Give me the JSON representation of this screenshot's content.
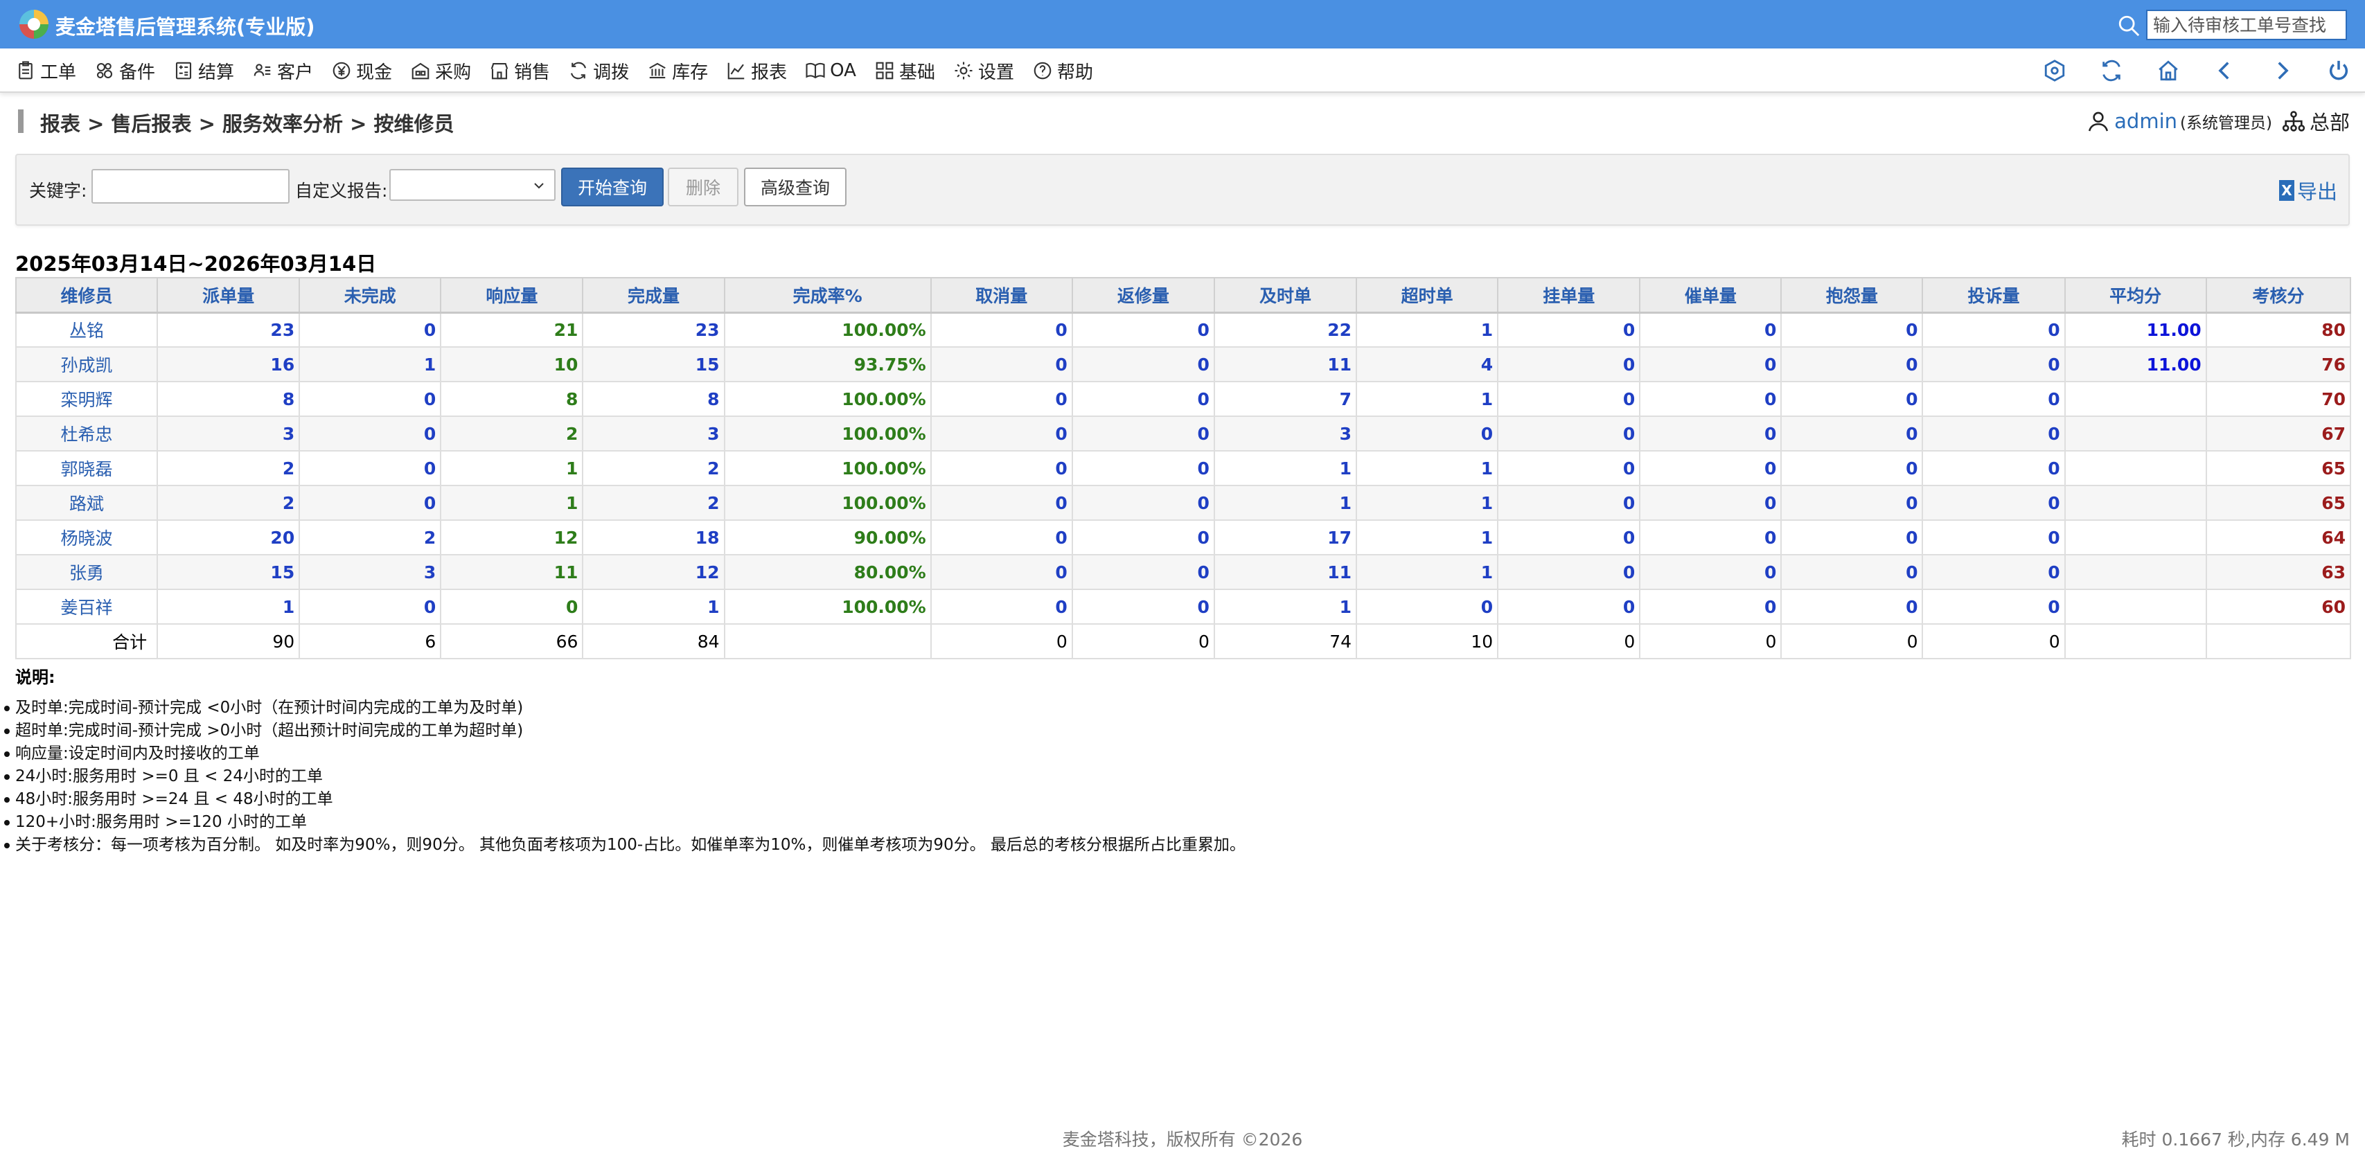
{
  "app": {
    "title": "麦金塔售后管理系统(专业版)",
    "search_placeholder": "输入待审核工单号查找"
  },
  "menu": [
    {
      "label": "工单",
      "icon": "clipboard-icon"
    },
    {
      "label": "备件",
      "icon": "parts-icon"
    },
    {
      "label": "结算",
      "icon": "calculator-icon"
    },
    {
      "label": "客户",
      "icon": "customer-card-icon"
    },
    {
      "label": "现金",
      "icon": "yen-icon"
    },
    {
      "label": "采购",
      "icon": "warehouse-icon"
    },
    {
      "label": "销售",
      "icon": "shop-icon"
    },
    {
      "label": "调拨",
      "icon": "transfer-icon"
    },
    {
      "label": "库存",
      "icon": "bank-icon"
    },
    {
      "label": "报表",
      "icon": "line-chart-icon"
    },
    {
      "label": "OA",
      "icon": "book-icon"
    },
    {
      "label": "基础",
      "icon": "grid-icon"
    },
    {
      "label": "设置",
      "icon": "gear-icon"
    },
    {
      "label": "帮助",
      "icon": "help-icon"
    }
  ],
  "toolbar_icons": [
    "dashboard-icon",
    "refresh-icon",
    "home-icon",
    "back-icon",
    "forward-icon",
    "logout-icon"
  ],
  "breadcrumb": "报表 > 售后报表 > 服务效率分析 > 按维修员",
  "user": {
    "name": "admin",
    "role": "(系统管理员)",
    "org": "总部"
  },
  "filter": {
    "keyword_label": "关键字:",
    "keyword_value": "",
    "report_label": "自定义报告:",
    "report_value": "",
    "query_button": "开始查询",
    "delete_button": "删除",
    "advanced_button": "高级查询",
    "export_icon_text": "X",
    "export_label": "导出"
  },
  "report": {
    "date_range": "2025年03月14日~2026年03月14日",
    "columns": [
      "维修员",
      "派单量",
      "未完成",
      "响应量",
      "完成量",
      "完成率%",
      "取消量",
      "返修量",
      "及时单",
      "超时单",
      "挂单量",
      "催单量",
      "抱怨量",
      "投诉量",
      "平均分",
      "考核分"
    ],
    "column_colors": [
      "name",
      "blue",
      "blue",
      "green",
      "blue",
      "green",
      "blue",
      "blue",
      "blue",
      "blue",
      "blue",
      "blue",
      "blue",
      "blue",
      "navy",
      "red"
    ],
    "rows": [
      [
        "丛铭",
        "23",
        "0",
        "21",
        "23",
        "100.00%",
        "0",
        "0",
        "22",
        "1",
        "0",
        "0",
        "0",
        "0",
        "11.00",
        "80"
      ],
      [
        "孙成凯",
        "16",
        "1",
        "10",
        "15",
        "93.75%",
        "0",
        "0",
        "11",
        "4",
        "0",
        "0",
        "0",
        "0",
        "11.00",
        "76"
      ],
      [
        "栾明辉",
        "8",
        "0",
        "8",
        "8",
        "100.00%",
        "0",
        "0",
        "7",
        "1",
        "0",
        "0",
        "0",
        "0",
        "",
        "70"
      ],
      [
        "杜希忠",
        "3",
        "0",
        "2",
        "3",
        "100.00%",
        "0",
        "0",
        "3",
        "0",
        "0",
        "0",
        "0",
        "0",
        "",
        "67"
      ],
      [
        "郭晓磊",
        "2",
        "0",
        "1",
        "2",
        "100.00%",
        "0",
        "0",
        "1",
        "1",
        "0",
        "0",
        "0",
        "0",
        "",
        "65"
      ],
      [
        "路斌",
        "2",
        "0",
        "1",
        "2",
        "100.00%",
        "0",
        "0",
        "1",
        "1",
        "0",
        "0",
        "0",
        "0",
        "",
        "65"
      ],
      [
        "杨晓波",
        "20",
        "2",
        "12",
        "18",
        "90.00%",
        "0",
        "0",
        "17",
        "1",
        "0",
        "0",
        "0",
        "0",
        "",
        "64"
      ],
      [
        "张勇",
        "15",
        "3",
        "11",
        "12",
        "80.00%",
        "0",
        "0",
        "11",
        "1",
        "0",
        "0",
        "0",
        "0",
        "",
        "63"
      ],
      [
        "姜百祥",
        "1",
        "0",
        "0",
        "1",
        "100.00%",
        "0",
        "0",
        "1",
        "0",
        "0",
        "0",
        "0",
        "0",
        "",
        "60"
      ]
    ],
    "total": [
      "合计",
      "90",
      "6",
      "66",
      "84",
      "",
      "0",
      "0",
      "74",
      "10",
      "0",
      "0",
      "0",
      "0",
      "",
      ""
    ]
  },
  "notes": {
    "title": "说明:",
    "items": [
      "及时单:完成时间-预计完成 <0小时（在预计时间内完成的工单为及时单)",
      "超时单:完成时间-预计完成 >0小时（超出预计时间完成的工单为超时单)",
      "响应量:设定时间内及时接收的工单",
      "24小时:服务用时 >=0 且 < 24小时的工单",
      "48小时:服务用时 >=24 且 < 48小时的工单",
      "120+小时:服务用时 >=120 小时的工单",
      "关于考核分：每一项考核为百分制。 如及时率为90%，则90分。 其他负面考核项为100-占比。如催单率为10%，则催单考核项为90分。 最后总的考核分根据所占比重累加。"
    ]
  },
  "footer": {
    "copyright": "麦金塔科技，版权所有 ©2026",
    "perf": "耗时 0.1667 秒,内存 6.49 M"
  }
}
